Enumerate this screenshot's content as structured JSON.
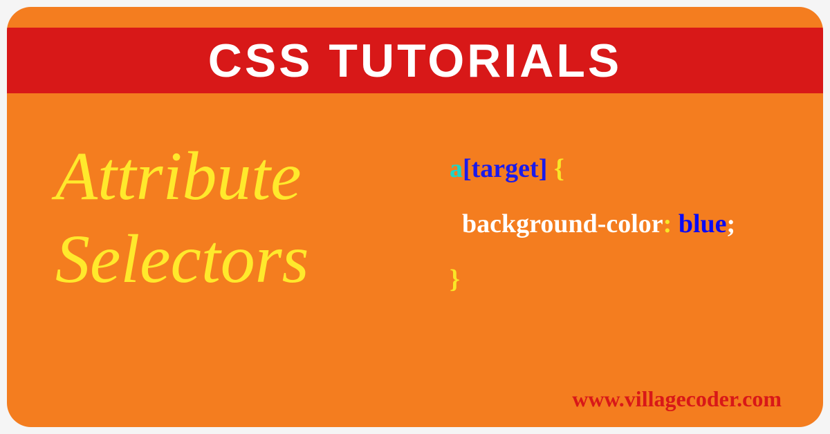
{
  "header": {
    "title": "CSS TUTORIALS"
  },
  "topic": {
    "line1": "Attribute",
    "line2": "Selectors"
  },
  "code": {
    "tag": "a",
    "attribute": "[target]",
    "open_brace": " {",
    "property": "background-color",
    "colon": ":",
    "value": " blue",
    "semicolon": ";",
    "close_brace": "}"
  },
  "footer": {
    "url": "www.villagecoder.com"
  }
}
